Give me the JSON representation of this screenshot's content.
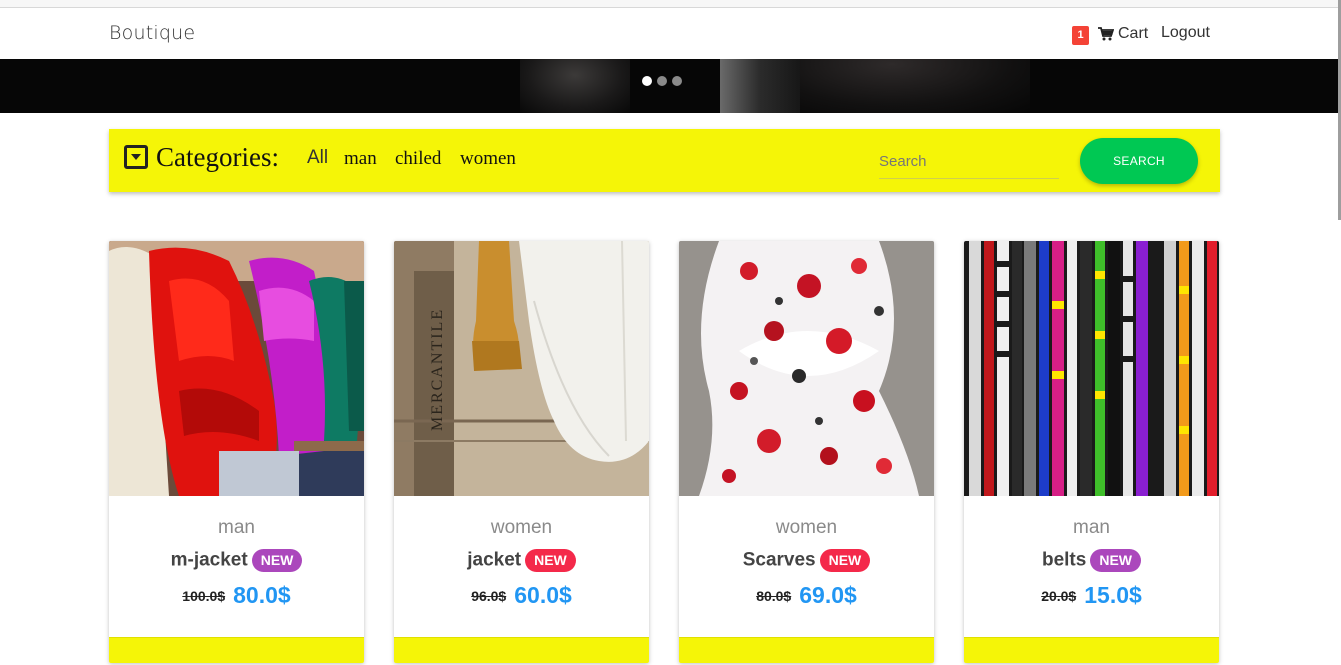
{
  "navbar": {
    "brand": "Boutique",
    "cart_count": "1",
    "cart_label": "Cart",
    "logout_label": "Logout"
  },
  "carousel": {
    "slides": 3,
    "active_index": 0
  },
  "categories": {
    "title": "Categories:",
    "items": [
      "All",
      "man",
      "chiled",
      "women"
    ],
    "search_placeholder": "Search",
    "search_button": "SEARCH"
  },
  "products": [
    {
      "category": "man",
      "name": "m-jacket",
      "badge": "NEW",
      "badge_color": "#ab47bc",
      "old_price": "100.0$",
      "price": "80.0$",
      "image": "red-puffer-jackets-photo"
    },
    {
      "category": "women",
      "name": "jacket",
      "badge": "NEW",
      "badge_color": "#f4294a",
      "old_price": "96.0$",
      "price": "60.0$",
      "image": "hanging-sweaters-photo"
    },
    {
      "category": "women",
      "name": "Scarves",
      "badge": "NEW",
      "badge_color": "#f4294a",
      "old_price": "80.0$",
      "price": "69.0$",
      "image": "floral-scarf-photo"
    },
    {
      "category": "man",
      "name": "belts",
      "badge": "NEW",
      "badge_color": "#ab47bc",
      "old_price": "20.0$",
      "price": "15.0$",
      "image": "hanging-belts-photo"
    }
  ],
  "colors": {
    "accent_yellow": "#f5f507",
    "search_green": "#00c853",
    "price_blue": "#2196f3",
    "badge_red": "#f44336"
  }
}
